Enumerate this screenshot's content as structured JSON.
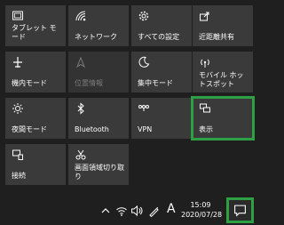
{
  "quick_actions": [
    {
      "label": "タブレット モード",
      "icon": "tablet-icon",
      "state": "normal"
    },
    {
      "label": "ネットワーク",
      "icon": "network-icon",
      "state": "normal"
    },
    {
      "label": "すべての設定",
      "icon": "gear-icon",
      "state": "normal"
    },
    {
      "label": "近距離共有",
      "icon": "nearby-share-icon",
      "state": "normal"
    },
    {
      "label": "機内モード",
      "icon": "airplane-icon",
      "state": "normal"
    },
    {
      "label": "位置情報",
      "icon": "location-icon",
      "state": "disabled"
    },
    {
      "label": "集中モード",
      "icon": "moon-icon",
      "state": "normal"
    },
    {
      "label": "モバイル ホットスポット",
      "icon": "hotspot-icon",
      "state": "normal"
    },
    {
      "label": "夜間モード",
      "icon": "brightness-icon",
      "state": "normal"
    },
    {
      "label": "Bluetooth",
      "icon": "bluetooth-icon",
      "state": "normal"
    },
    {
      "label": "VPN",
      "icon": "vpn-icon",
      "state": "normal"
    },
    {
      "label": "表示",
      "icon": "project-icon",
      "state": "selected"
    },
    {
      "label": "接続",
      "icon": "connect-icon",
      "state": "normal"
    },
    {
      "label": "画面領域切り取り",
      "icon": "screen-snip-icon",
      "state": "normal"
    }
  ],
  "taskbar": {
    "time": "15:09",
    "date": "2020/07/28",
    "ime": "A",
    "tray_icons": [
      "chevron-up-icon",
      "wifi-icon",
      "volume-icon"
    ],
    "action_center_icon": "notification-icon"
  },
  "colors": {
    "highlight": "#2ea043",
    "tile": "#3a3a3a",
    "background": "#1f1f1f"
  }
}
